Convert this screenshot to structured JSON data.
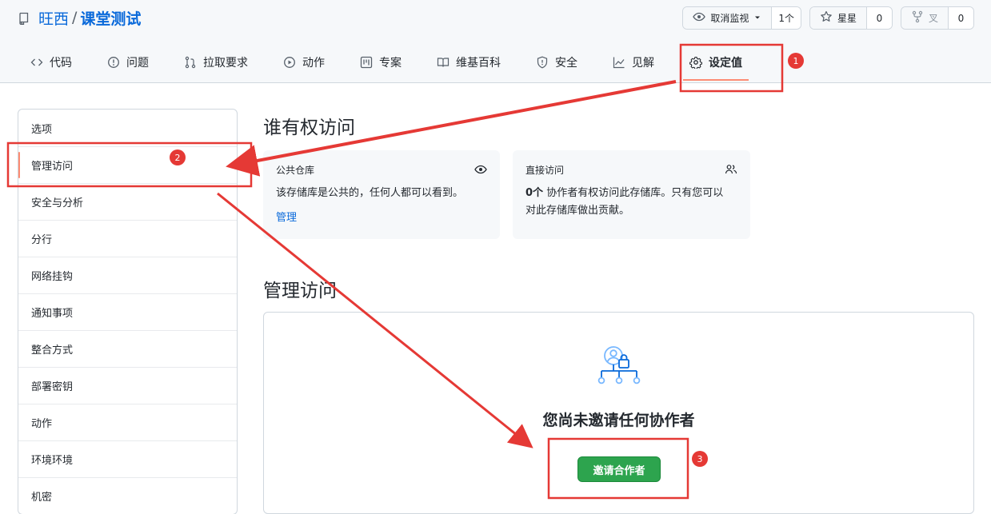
{
  "repo": {
    "owner": "旺西",
    "separator": "/",
    "name": "课堂测试"
  },
  "header_buttons": [
    {
      "label": "取消监视",
      "count": "1个",
      "icon": "eye-icon"
    },
    {
      "label": "星星",
      "count": "0",
      "icon": "star-icon"
    },
    {
      "label": "叉",
      "count": "0",
      "icon": "fork-icon"
    }
  ],
  "tabs": [
    {
      "label": "代码",
      "icon": "code-icon"
    },
    {
      "label": "问题",
      "icon": "issue-icon"
    },
    {
      "label": "拉取要求",
      "icon": "pull-request-icon"
    },
    {
      "label": "动作",
      "icon": "play-icon"
    },
    {
      "label": "专案",
      "icon": "project-icon"
    },
    {
      "label": "维基百科",
      "icon": "book-icon"
    },
    {
      "label": "安全",
      "icon": "shield-icon"
    },
    {
      "label": "见解",
      "icon": "graph-icon"
    },
    {
      "label": "设定值",
      "icon": "gear-icon",
      "active": true
    }
  ],
  "sidebar": {
    "items": [
      {
        "label": "选项"
      },
      {
        "label": "管理访问",
        "active": true
      },
      {
        "label": "安全与分析"
      },
      {
        "label": "分行"
      },
      {
        "label": "网络挂钩"
      },
      {
        "label": "通知事项"
      },
      {
        "label": "整合方式"
      },
      {
        "label": "部署密钥"
      },
      {
        "label": "动作"
      },
      {
        "label": "环境环境"
      },
      {
        "label": "机密"
      }
    ]
  },
  "access": {
    "title": "谁有权访问",
    "public_card": {
      "label": "公共仓库",
      "desc": "该存储库是公共的，任何人都可以看到。",
      "link": "管理",
      "icon": "eye-icon"
    },
    "direct_card": {
      "label": "直接访问",
      "count": "0个",
      "desc_rest": "协作者有权访问此存储库。只有您可以",
      "desc_line2": "对此存储库做出贡献。",
      "icon": "people-icon"
    }
  },
  "manage": {
    "title": "管理访问",
    "empty_text": "您尚未邀请任何协作者",
    "invite_button": "邀请合作者"
  },
  "annotations": [
    "1",
    "2",
    "3"
  ],
  "colors": {
    "annotation_red": "#e53935",
    "accent_blue": "#0969da",
    "button_green": "#2da44e",
    "active_underline": "#fd8c73"
  }
}
